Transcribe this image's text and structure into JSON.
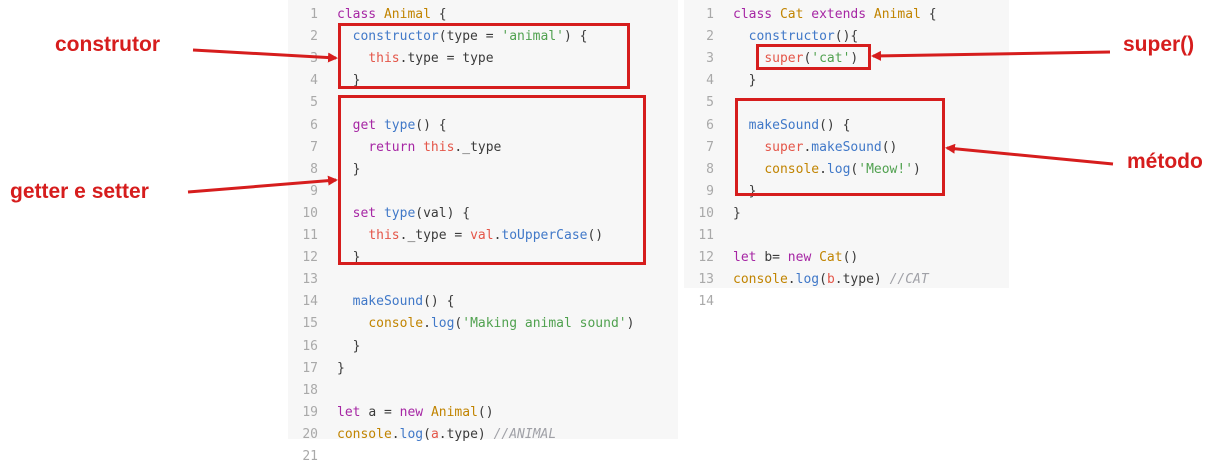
{
  "left_code": [
    {
      "n": "1",
      "t": [
        [
          "kw",
          "class "
        ],
        [
          "cls",
          "Animal"
        ],
        [
          "",
          ""
        ],
        [
          "",
          " {"
        ]
      ]
    },
    {
      "n": "2",
      "t": [
        [
          "",
          "  "
        ],
        [
          "fn",
          "constructor"
        ],
        [
          "",
          "(type = "
        ],
        [
          "str",
          "'animal'"
        ],
        [
          "",
          ") {"
        ]
      ]
    },
    {
      "n": "3",
      "t": [
        [
          "",
          "    "
        ],
        [
          "this",
          "this"
        ],
        [
          "",
          ".type = type"
        ]
      ]
    },
    {
      "n": "4",
      "t": [
        [
          "",
          "  }"
        ]
      ]
    },
    {
      "n": "5",
      "t": []
    },
    {
      "n": "6",
      "t": [
        [
          "",
          "  "
        ],
        [
          "kw",
          "get "
        ],
        [
          "fn",
          "type"
        ],
        [
          "",
          "() {"
        ]
      ]
    },
    {
      "n": "7",
      "t": [
        [
          "",
          "    "
        ],
        [
          "kw",
          "return "
        ],
        [
          "this",
          "this"
        ],
        [
          "",
          "._type"
        ]
      ]
    },
    {
      "n": "8",
      "t": [
        [
          "",
          "  }"
        ]
      ]
    },
    {
      "n": "9",
      "t": []
    },
    {
      "n": "10",
      "t": [
        [
          "",
          "  "
        ],
        [
          "kw",
          "set "
        ],
        [
          "fn",
          "type"
        ],
        [
          "",
          "(val) {"
        ]
      ]
    },
    {
      "n": "11",
      "t": [
        [
          "",
          "    "
        ],
        [
          "this",
          "this"
        ],
        [
          "",
          "._type = "
        ],
        [
          "this",
          "val"
        ],
        [
          "",
          "."
        ],
        [
          "fn",
          "toUpperCase"
        ],
        [
          "",
          "()"
        ]
      ]
    },
    {
      "n": "12",
      "t": [
        [
          "",
          "  }"
        ]
      ]
    },
    {
      "n": "13",
      "t": []
    },
    {
      "n": "14",
      "t": [
        [
          "",
          "  "
        ],
        [
          "fn",
          "makeSound"
        ],
        [
          "",
          "() {"
        ]
      ]
    },
    {
      "n": "15",
      "t": [
        [
          "",
          "    "
        ],
        [
          "cls",
          "console"
        ],
        [
          "",
          "."
        ],
        [
          "fn",
          "log"
        ],
        [
          "",
          "("
        ],
        [
          "str",
          "'Making animal sound'"
        ],
        [
          "",
          ")"
        ]
      ]
    },
    {
      "n": "16",
      "t": [
        [
          "",
          "  }"
        ]
      ]
    },
    {
      "n": "17",
      "t": [
        [
          "",
          "}"
        ]
      ]
    },
    {
      "n": "18",
      "t": []
    },
    {
      "n": "19",
      "t": [
        [
          "kw",
          "let "
        ],
        [
          "",
          "a = "
        ],
        [
          "kw",
          "new "
        ],
        [
          "cls",
          "Animal"
        ],
        [
          "",
          "()"
        ]
      ]
    },
    {
      "n": "20",
      "t": [
        [
          "cls",
          "console"
        ],
        [
          "",
          "."
        ],
        [
          "fn",
          "log"
        ],
        [
          "",
          "("
        ],
        [
          "this",
          "a"
        ],
        [
          "",
          ".type) "
        ],
        [
          "cm",
          "//ANIMAL"
        ]
      ]
    },
    {
      "n": "21",
      "t": []
    }
  ],
  "right_code": [
    {
      "n": "1",
      "t": [
        [
          "kw",
          "class "
        ],
        [
          "cls",
          "Cat "
        ],
        [
          "kw",
          "extends "
        ],
        [
          "cls",
          "Animal"
        ],
        [
          "",
          " {"
        ]
      ]
    },
    {
      "n": "2",
      "t": [
        [
          "",
          "  "
        ],
        [
          "fn",
          "constructor"
        ],
        [
          "",
          "(){"
        ]
      ]
    },
    {
      "n": "3",
      "t": [
        [
          "",
          "    "
        ],
        [
          "this",
          "super"
        ],
        [
          "",
          "("
        ],
        [
          "str",
          "'cat'"
        ],
        [
          "",
          ")"
        ]
      ]
    },
    {
      "n": "4",
      "t": [
        [
          "",
          "  }"
        ]
      ]
    },
    {
      "n": "5",
      "t": []
    },
    {
      "n": "6",
      "t": [
        [
          "",
          "  "
        ],
        [
          "fn",
          "makeSound"
        ],
        [
          "",
          "() {"
        ]
      ]
    },
    {
      "n": "7",
      "t": [
        [
          "",
          "    "
        ],
        [
          "this",
          "super"
        ],
        [
          "",
          "."
        ],
        [
          "fn",
          "makeSound"
        ],
        [
          "",
          "()"
        ]
      ]
    },
    {
      "n": "8",
      "t": [
        [
          "",
          "    "
        ],
        [
          "cls",
          "console"
        ],
        [
          "",
          "."
        ],
        [
          "fn",
          "log"
        ],
        [
          "",
          "("
        ],
        [
          "str",
          "'Meow!'"
        ],
        [
          "",
          ")"
        ]
      ]
    },
    {
      "n": "9",
      "t": [
        [
          "",
          "  }"
        ]
      ]
    },
    {
      "n": "10",
      "t": [
        [
          "",
          "}"
        ]
      ]
    },
    {
      "n": "11",
      "t": []
    },
    {
      "n": "12",
      "t": [
        [
          "kw",
          "let "
        ],
        [
          "",
          "b= "
        ],
        [
          "kw",
          "new "
        ],
        [
          "cls",
          "Cat"
        ],
        [
          "",
          "()"
        ]
      ]
    },
    {
      "n": "13",
      "t": [
        [
          "cls",
          "console"
        ],
        [
          "",
          "."
        ],
        [
          "fn",
          "log"
        ],
        [
          "",
          "("
        ],
        [
          "this",
          "b"
        ],
        [
          "",
          ".type) "
        ],
        [
          "cm",
          "//CAT"
        ]
      ]
    },
    {
      "n": "14",
      "t": []
    }
  ],
  "callouts": {
    "constructor": "construtor",
    "getter_setter": "getter e setter",
    "super": "super()",
    "method": "método"
  },
  "colors": {
    "annotation": "#d61d1d",
    "keyword": "#a626a4",
    "function": "#4078c8",
    "class": "#c18401",
    "string": "#50a14f",
    "this": "#e45649",
    "comment": "#a0a1a7"
  }
}
